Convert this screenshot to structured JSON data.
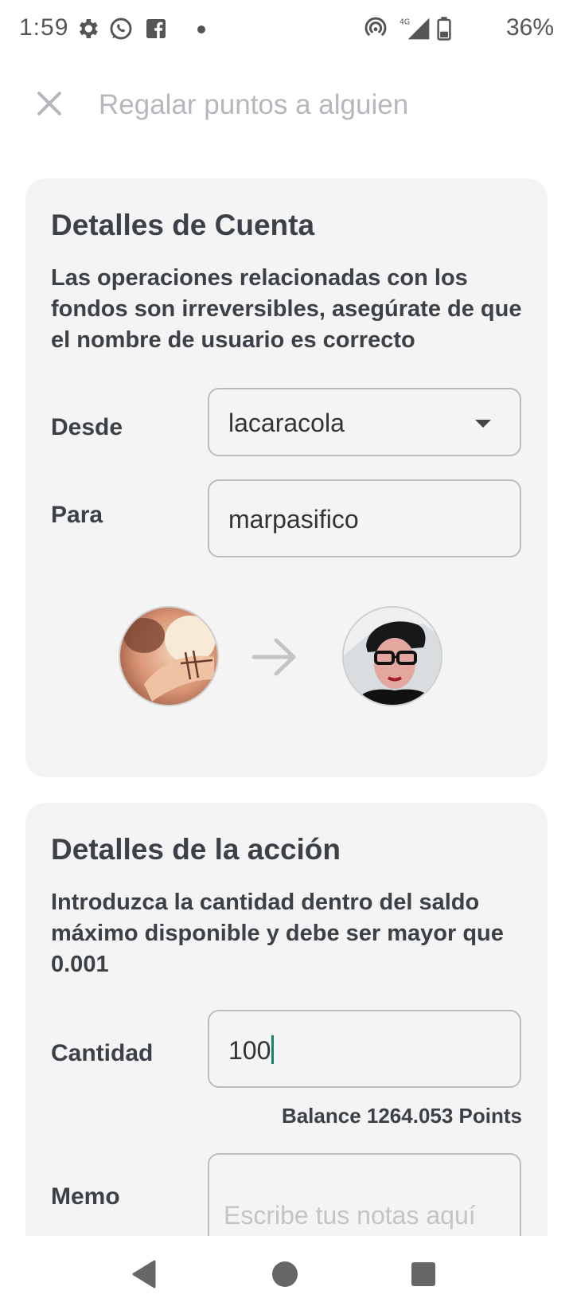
{
  "status_bar": {
    "time": "1:59",
    "network": "4G",
    "battery": "36%",
    "icons": [
      "gear-icon",
      "whatsapp-icon",
      "facebook-icon",
      "notification-dot",
      "hotspot-icon",
      "signal-icon",
      "battery-icon"
    ]
  },
  "header": {
    "title": "Regalar puntos a alguien",
    "close_icon": "close-icon"
  },
  "account": {
    "title": "Detalles de Cuenta",
    "description": "Las operaciones relacionadas con los fondos son irreversibles, asegúrate de que el nombre de usuario es correcto",
    "from_label": "Desde",
    "from_value": "lacaracola",
    "to_label": "Para",
    "to_value": "marpasifico"
  },
  "action": {
    "title": "Detalles de la acción",
    "description": "Introduzca la cantidad dentro del saldo máximo disponible  y debe ser mayor que 0.001",
    "amount_label": "Cantidad",
    "amount_value": "100",
    "balance": "Balance 1264.053 Points",
    "memo_label": "Memo",
    "memo_placeholder": "Escribe tus notas aquí"
  },
  "nav": {
    "back": "back-icon",
    "home": "home-icon",
    "recents": "recents-icon"
  },
  "colors": {
    "accent_cursor": "#1b7f6e",
    "card_bg": "#f4f4f4",
    "title_text": "#3c4148",
    "header_text": "#b4b8bd"
  }
}
